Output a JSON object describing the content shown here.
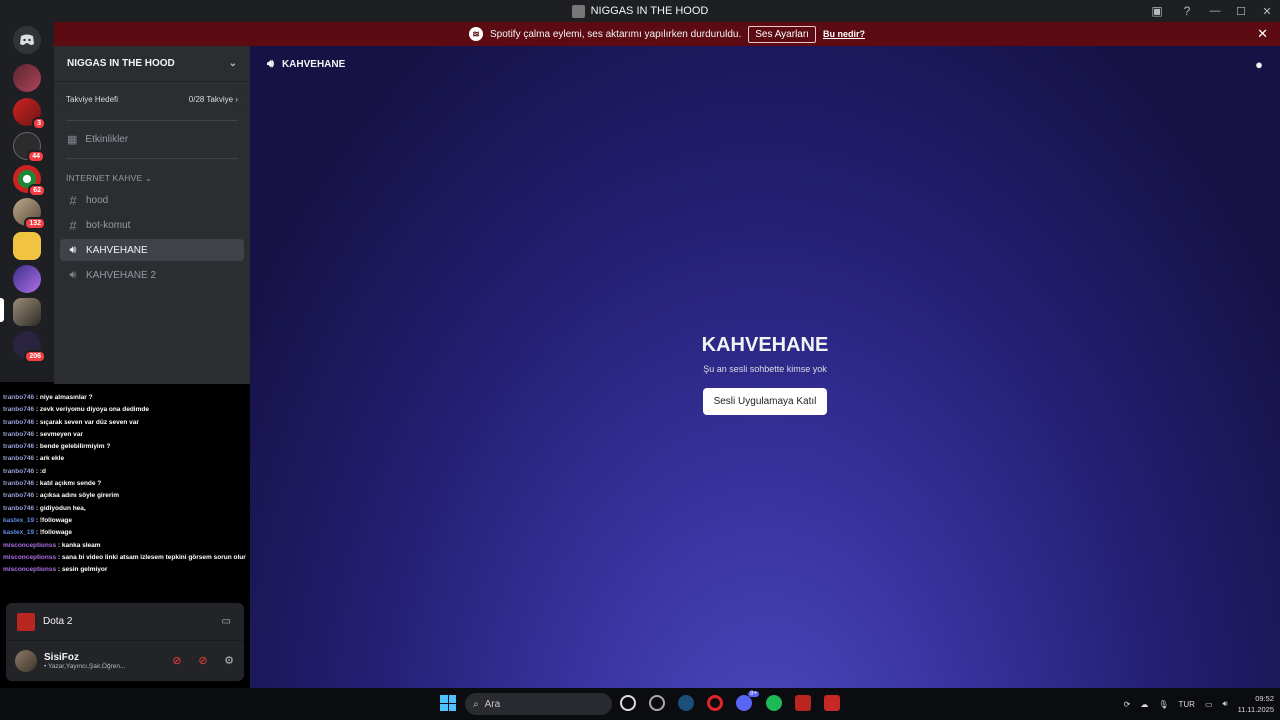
{
  "window": {
    "title": "NIGGAS IN THE HOOD"
  },
  "notice": {
    "text": "Spotify çalma eylemi, ses aktarımı yapılırken durduruldu.",
    "button_label": "Ses Ayarları",
    "link_label": "Bu nedir?",
    "close": "✕"
  },
  "guild_badges": [
    "3",
    "44",
    "62",
    "132",
    "206"
  ],
  "server": {
    "name": "NIGGAS IN THE HOOD",
    "boost_label": "Takviye Hedefi",
    "boost_value": "0/28 Takviye",
    "events_label": "Etkinlikler",
    "category": "İNTERNET KAHVE",
    "channels": [
      "hood",
      "bot-komut",
      "KAHVEHANE",
      "KAHVEHANE 2"
    ]
  },
  "overlay_chat": [
    {
      "user": "tranbo746",
      "text": ": niye almasınlar ?"
    },
    {
      "user": "tranbo746",
      "text": ": zevk veriyomu diyoya ona dedimde"
    },
    {
      "user": "tranbo746",
      "text": ": sıçarak seven var düz seven var"
    },
    {
      "user": "tranbo746",
      "text": ": sevmeyen var"
    },
    {
      "user": "tranbo746",
      "text": ": bende gelebilirmiyim ?"
    },
    {
      "user": "tranbo746",
      "text": ": ark ekle"
    },
    {
      "user": "tranbo746",
      "text": ": :d"
    },
    {
      "user": "tranbo746",
      "text": ": katıl açıkmı sende ?"
    },
    {
      "user": "tranbo746",
      "text": ": açıksa adını söyle girerim"
    },
    {
      "user": "tranbo746",
      "text": ": gidiyodun hea,"
    },
    {
      "user": "kastex_19",
      "text": ": !followage"
    },
    {
      "user": "kastex_19",
      "text": ": !followage"
    },
    {
      "user": "misconceptionss",
      "text": ": kanka sleam"
    },
    {
      "user": "misconceptionss",
      "text": ": sana bi video linki atsam izlesem tepkini görsem sorun olur mu"
    },
    {
      "user": "misconceptionss",
      "text": ": sesin gelmiyor"
    }
  ],
  "activity": {
    "game": "Dota 2"
  },
  "user": {
    "name": "SisiFoz",
    "status": "• Yazar,Yayıncı,Şair,Öğren..."
  },
  "main": {
    "channel_title": "KAHVEHANE",
    "big_title": "KAHVEHANE",
    "subtitle": "Şu an sesli sohbette kimse yok",
    "join_button": "Sesli Uygulamaya Katıl"
  },
  "taskbar": {
    "search_placeholder": "Ara",
    "language": "TUR",
    "time": "09:52",
    "date": "11.11.2025",
    "discord_badge": "9+"
  },
  "colors": {
    "accent_red": "#f23f43",
    "notice_bg": "#5c0b12",
    "sidebar": "#2b2d31",
    "rail": "#1e1f22"
  }
}
